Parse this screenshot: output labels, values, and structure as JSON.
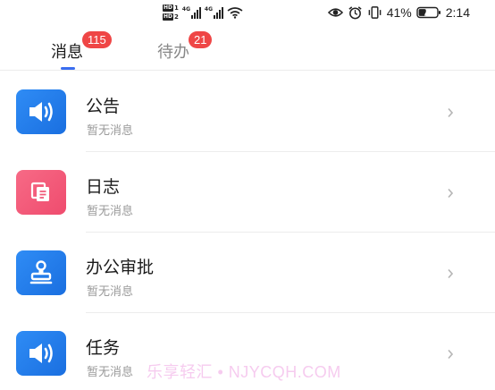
{
  "status_bar": {
    "sim1_tag": "HD",
    "sim1_num": "1",
    "sim2_tag": "HD",
    "sim2_num": "2",
    "network1": "4G",
    "network2": "4G",
    "icons": [
      "eye-comfort-icon",
      "alarm-icon",
      "vibrate-icon",
      "battery-icon"
    ],
    "battery_percent": "41%",
    "battery_level": 0.41,
    "time": "2:14"
  },
  "tabs": [
    {
      "label": "消息",
      "badge": "115",
      "active": true
    },
    {
      "label": "待办",
      "badge": "21",
      "active": false
    }
  ],
  "colors": {
    "accent": "#3a6df0",
    "badge": "#ef4646",
    "icon_blue": "#1f7ae8",
    "icon_pink": "#f15a79"
  },
  "items": [
    {
      "title": "公告",
      "subtitle": "暂无消息",
      "icon": "megaphone-icon"
    },
    {
      "title": "日志",
      "subtitle": "暂无消息",
      "icon": "document-copy-icon"
    },
    {
      "title": "办公审批",
      "subtitle": "暂无消息",
      "icon": "stamp-icon"
    },
    {
      "title": "任务",
      "subtitle": "暂无消息",
      "icon": "megaphone-icon"
    }
  ],
  "watermark": "乐享轻汇 • NJYCQH.COM"
}
